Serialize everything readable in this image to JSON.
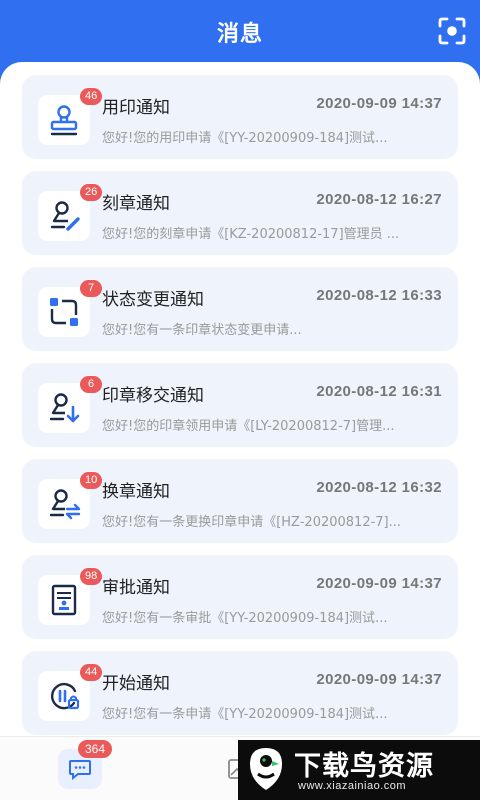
{
  "header": {
    "title": "消息",
    "scan_icon": "scan-icon"
  },
  "colors": {
    "primary": "#2f6ff0",
    "badge": "#ea5a5a",
    "card_bg": "#eef3fc"
  },
  "messages": [
    {
      "icon": "stamp-icon",
      "badge": "46",
      "title": "用印通知",
      "time": "2020-09-09 14:37",
      "preview": "您好!您的用印申请《[YY-20200909-184]测试..."
    },
    {
      "icon": "stamp-engrave-icon",
      "badge": "26",
      "title": "刻章通知",
      "time": "2020-08-12 16:27",
      "preview": "您好!您的刻章申请《[KZ-20200812-17]管理员 ..."
    },
    {
      "icon": "status-sync-icon",
      "badge": "7",
      "title": "状态变更通知",
      "time": "2020-08-12 16:33",
      "preview": "您好!您有一条印章状态变更申请..."
    },
    {
      "icon": "stamp-transfer-icon",
      "badge": "6",
      "title": "印章移交通知",
      "time": "2020-08-12 16:31",
      "preview": "您好!您的印章领用申请《[LY-20200812-7]管理..."
    },
    {
      "icon": "stamp-exchange-icon",
      "badge": "10",
      "title": "换章通知",
      "time": "2020-08-12 16:32",
      "preview": "您好!您有一条更换印章申请《[HZ-20200812-7]..."
    },
    {
      "icon": "approval-document-icon",
      "badge": "98",
      "title": "审批通知",
      "time": "2020-09-09 14:37",
      "preview": "您好!您有一条审批《[YY-20200909-184]测试..."
    },
    {
      "icon": "start-icon",
      "badge": "44",
      "title": "开始通知",
      "time": "2020-09-09 14:37",
      "preview": "您好!您有一条申请《[YY-20200909-184]测试..."
    }
  ],
  "tabbar": {
    "messages_badge": "364",
    "messages_icon": "message-icon",
    "second_icon": "image-icon"
  },
  "watermark": {
    "title": "下载鸟资源",
    "url": "www.xiazainiao.com"
  }
}
